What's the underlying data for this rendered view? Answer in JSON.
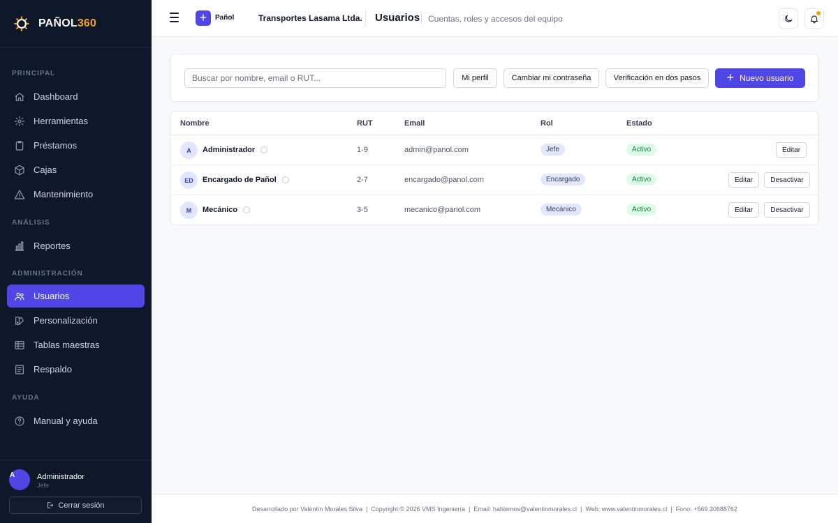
{
  "brand": {
    "name": "PAÑOL",
    "name_accent": "360"
  },
  "sidebar": {
    "sections": [
      {
        "title": "PRINCIPAL"
      },
      {
        "title": "ANÁLISIS"
      },
      {
        "title": "ADMINISTRACIÓN"
      },
      {
        "title": "AYUDA"
      }
    ],
    "items": [
      {
        "label": "Dashboard",
        "icon": "home-icon"
      },
      {
        "label": "Herramientas",
        "icon": "gear-icon"
      },
      {
        "label": "Préstamos",
        "icon": "clipboard-icon"
      },
      {
        "label": "Cajas",
        "icon": "box-icon"
      },
      {
        "label": "Mantenimiento",
        "icon": "warning-icon"
      },
      {
        "label": "Reportes",
        "icon": "bar-chart-icon"
      },
      {
        "label": "Usuarios",
        "icon": "users-icon",
        "active": true
      },
      {
        "label": "Personalización",
        "icon": "palette-icon"
      },
      {
        "label": "Tablas maestras",
        "icon": "table-icon"
      },
      {
        "label": "Respaldo",
        "icon": "document-icon"
      },
      {
        "label": "Manual y ayuda",
        "icon": "help-icon"
      }
    ],
    "user": {
      "avatar": "A",
      "name": "Administrador",
      "role": "Jefe"
    },
    "logout_label": "Cerrar sesión"
  },
  "header": {
    "badge_label": "Pañol",
    "company": "Transportes Lasama Ltda.",
    "title": "Usuarios",
    "subtitle": "Cuentas, roles y accesos del equipo"
  },
  "toolbar": {
    "search_placeholder": "Buscar por nombre, email o RUT...",
    "profile_label": "Mi perfil",
    "password_label": "Cambiar mi contraseña",
    "twofa_label": "Verificación en dos pasos",
    "new_user_label": "Nuevo usuario"
  },
  "table": {
    "columns": [
      "Nombre",
      "RUT",
      "Email",
      "Rol",
      "Estado"
    ],
    "rows": [
      {
        "initials": "A",
        "name": "Administrador",
        "rut": "1-9",
        "email": "admin@panol.com",
        "role": "Jefe",
        "status": "Activo",
        "actions": [
          "Editar"
        ]
      },
      {
        "initials": "ED",
        "name": "Encargado de Pañol",
        "rut": "2-7",
        "email": "encargado@panol.com",
        "role": "Encargado",
        "status": "Activo",
        "actions": [
          "Editar",
          "Desactivar"
        ]
      },
      {
        "initials": "M",
        "name": "Mecánico",
        "rut": "3-5",
        "email": "mecanico@panol.com",
        "role": "Mecánico",
        "status": "Activo",
        "actions": [
          "Editar",
          "Desactivar"
        ]
      }
    ]
  },
  "footer": {
    "text": "Desarrollado por Valentín Morales Silva  |  Copyright © 2026 VMS Ingeniería  |  Email: hablemos@valentinmorales.cl  |  Web: www.valentinmorales.cl  |  Fono: +569 30688762"
  },
  "colors": {
    "accent": "#4f46e5",
    "sidebar_bg": "#0f172a",
    "brand_accent": "#f5a524",
    "status_active": "#15803d"
  }
}
